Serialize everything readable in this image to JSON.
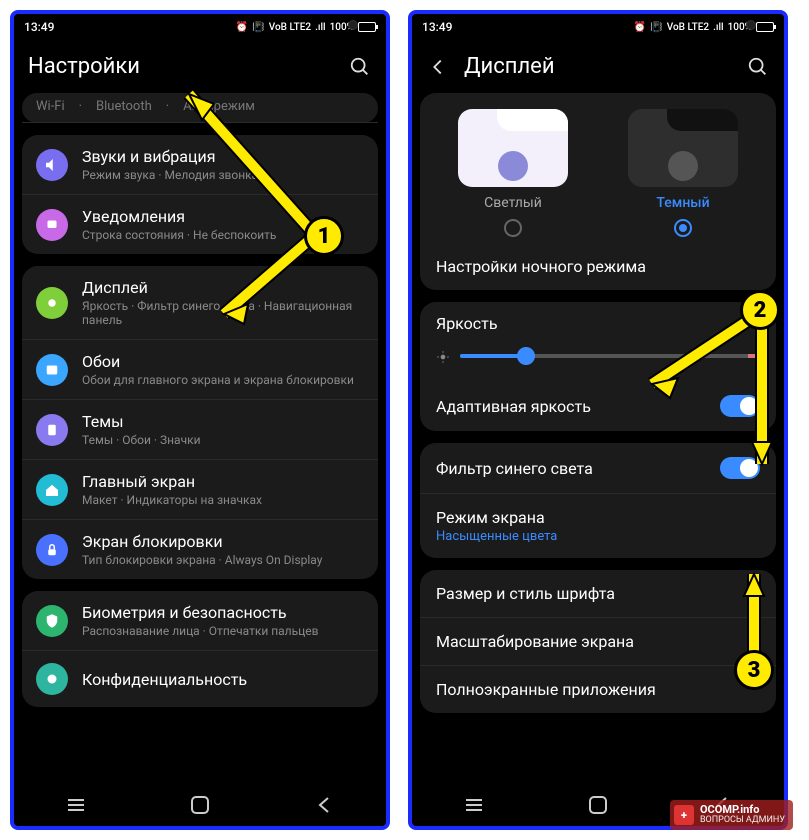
{
  "statusbar": {
    "time": "13:49",
    "net": "VoB LTE2",
    "signal": ".ıll",
    "battery_pct": "100%"
  },
  "left": {
    "title": "Настройки",
    "tabs": {
      "t0": "Wi-Fi",
      "t1": "Bluetooth",
      "t2": "Авиарежим"
    },
    "items": [
      {
        "label": "Звуки и вибрация",
        "sub": "Режим звука · Мелодия звонка",
        "color": "#7a6ef0",
        "icon": "volume"
      },
      {
        "label": "Уведомления",
        "sub": "Строка состояния · Не беспокоить",
        "color": "#c86ae8",
        "icon": "bell"
      },
      {
        "label": "Дисплей",
        "sub": "Яркость · Фильтр синего света · Навигационная панель",
        "color": "#7fcf3a",
        "icon": "sun"
      },
      {
        "label": "Обои",
        "sub": "Обои для главного экрана и экрана блокировки",
        "color": "#3aa6ff",
        "icon": "picture"
      },
      {
        "label": "Темы",
        "sub": "Темы · Обои · Значки",
        "color": "#8a7af0",
        "icon": "palette"
      },
      {
        "label": "Главный экран",
        "sub": "Макет · Индикаторы на значках",
        "color": "#22bcd4",
        "icon": "home"
      },
      {
        "label": "Экран блокировки",
        "sub": "Тип блокировки экрана · Always On Display",
        "color": "#4a70ff",
        "icon": "lock"
      },
      {
        "label": "Биометрия и безопасность",
        "sub": "Распознавание лица · Отпечатки пальцев",
        "color": "#2db56f",
        "icon": "shield"
      },
      {
        "label": "Конфиденциальность",
        "sub": "",
        "color": "#2db5a0",
        "icon": "privacy"
      }
    ]
  },
  "right": {
    "title": "Дисплей",
    "theme": {
      "light": "Светлый",
      "dark": "Темный",
      "selected": "dark"
    },
    "night_mode": "Настройки ночного режима",
    "brightness_label": "Яркость",
    "brightness_pct": 22,
    "adaptive": "Адаптивная яркость",
    "blue_filter": "Фильтр синего света",
    "screen_mode": "Режим экрана",
    "screen_mode_sub": "Насыщенные цвета",
    "font": "Размер и стиль шрифта",
    "scale": "Масштабирование экрана",
    "fullscreen_apps": "Полноэкранные приложения"
  },
  "anno": {
    "n1": "1",
    "n2": "2",
    "n3": "3"
  },
  "watermark": {
    "l1": "OCOMP.info",
    "l2": "ВОПРОСЫ АДМИНУ"
  }
}
